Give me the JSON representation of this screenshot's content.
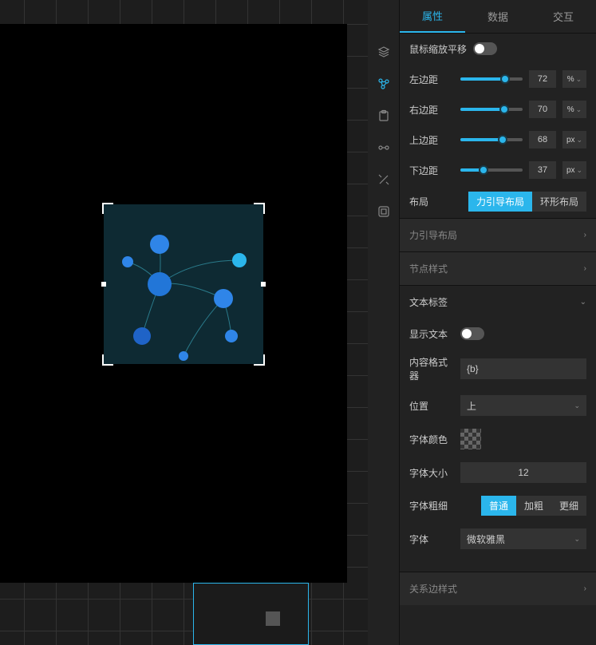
{
  "tabs": {
    "attr": "属性",
    "data": "数据",
    "interact": "交互"
  },
  "mouse_zoom_pan": {
    "label": "鼠标缩放平移"
  },
  "margins": {
    "left": {
      "label": "左边距",
      "value": "72",
      "unit": "%",
      "pct": 72
    },
    "right": {
      "label": "右边距",
      "value": "70",
      "unit": "%",
      "pct": 70
    },
    "top": {
      "label": "上边距",
      "value": "68",
      "unit": "px",
      "pct": 68
    },
    "bottom": {
      "label": "下边距",
      "value": "37",
      "unit": "px",
      "pct": 37
    }
  },
  "layout_row": {
    "label": "布局",
    "force": "力引导布局",
    "ring": "环形布局"
  },
  "sections": {
    "force_layout": "力引导布局",
    "node_style": "节点样式",
    "text_label": "文本标签",
    "edge_style": "关系边样式"
  },
  "text_label": {
    "show": "显示文本",
    "formatter_label": "内容格式器",
    "formatter_value": "{b}",
    "position_label": "位置",
    "position_value": "上",
    "font_color": "字体颜色",
    "font_size_label": "字体大小",
    "font_size_value": "12",
    "font_weight_label": "字体粗细",
    "weight_normal": "普通",
    "weight_bold": "加粗",
    "weight_lighter": "更细",
    "font_family_label": "字体",
    "font_family_value": "微软雅黑"
  }
}
